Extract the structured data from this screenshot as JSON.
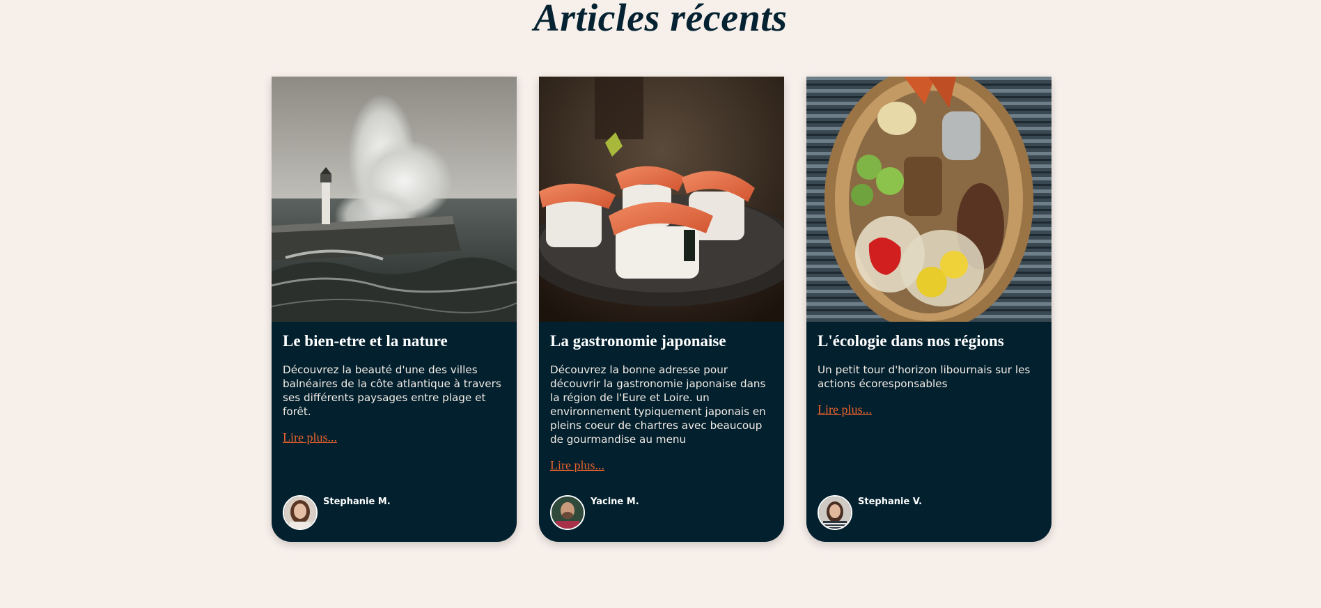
{
  "page": {
    "title": "Articles récents"
  },
  "articles": [
    {
      "title": "Le bien-etre et la nature",
      "text": "Découvrez la beauté d'une des villes balnéaires de la côte atlantique à travers ses différents paysages entre plage et forêt.",
      "link": "Lire plus...",
      "author": "Stephanie M.",
      "image": "lighthouse-storm-photo",
      "avatar": "woman-portrait-avatar"
    },
    {
      "title": "La gastronomie japonaise",
      "text": "Découvrez la bonne adresse pour découvrir la gastronomie japonaise dans la région de l'Eure et Loire. un environnement typiquement japonais en pleins coeur de chartres avec beaucoup de gourmandise au menu",
      "link": "Lire plus...",
      "author": "Yacine M.",
      "image": "salmon-sushi-photo",
      "avatar": "man-portrait-avatar"
    },
    {
      "title": "L'écologie dans nos régions",
      "text": "Un petit tour d'horizon libournais sur les actions écoresponsables",
      "link": "Lire plus...",
      "author": "Stephanie V.",
      "image": "vegetable-basket-photo",
      "avatar": "woman-portrait-avatar"
    }
  ],
  "colors": {
    "background": "#f7efea",
    "card": "#02202e",
    "title": "#042231",
    "link": "#e8622c"
  }
}
